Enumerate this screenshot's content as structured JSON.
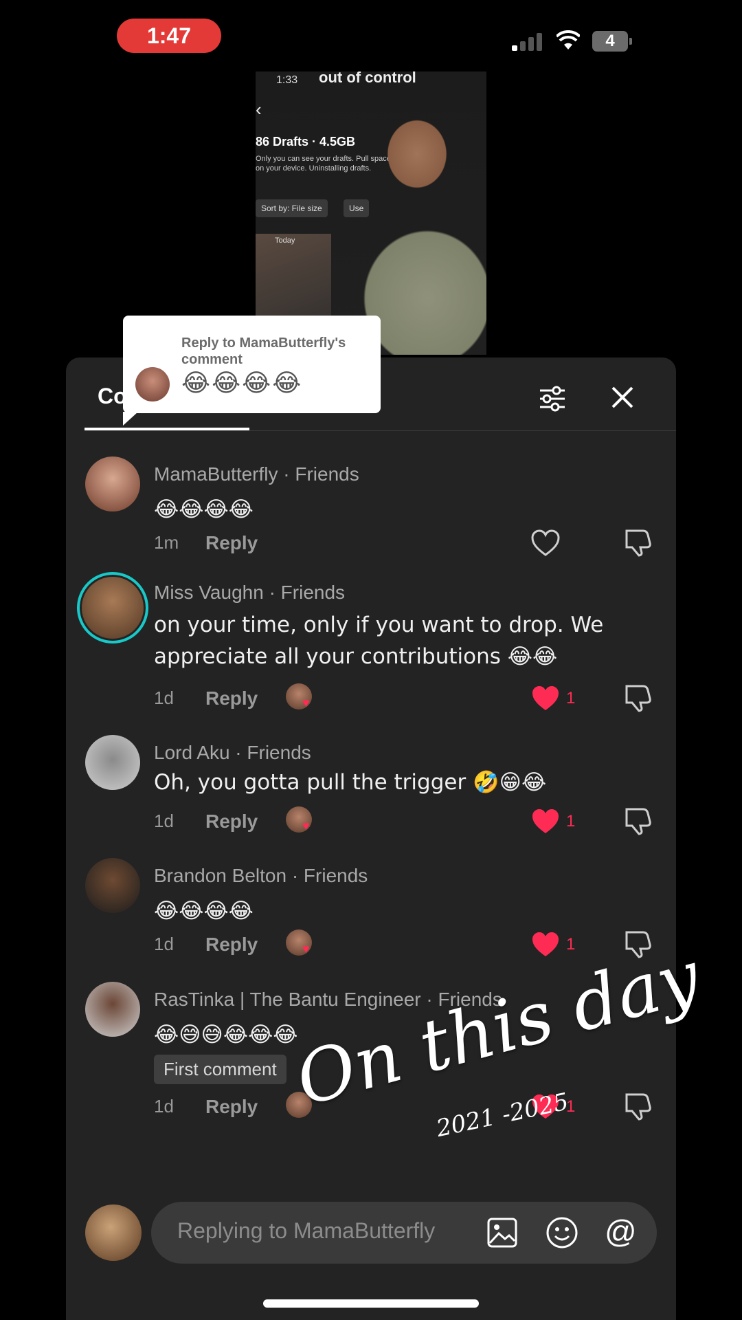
{
  "status_bar": {
    "time": "1:47",
    "battery": "4"
  },
  "video": {
    "inner_time": "1:33",
    "inner_caption": "out of control",
    "drafts_title": "86 Drafts · 4.5GB",
    "drafts_desc": "Only you can see your drafts. Pull space on your device. Uninstalling drafts.",
    "sort_label": "Sort by: File size",
    "sort_label_2": "Use",
    "thumb_label": "Today"
  },
  "reply_tooltip": {
    "title": "Reply to MamaButterfly's comment",
    "emoji": "😂😂😂😂"
  },
  "panel": {
    "tab_label": "Co",
    "comments": [
      {
        "name": "MamaButterfly · Friends",
        "text": "😂😂😂😂",
        "time": "1m",
        "reply": "Reply",
        "likes": ""
      },
      {
        "name": "Miss Vaughn · Friends",
        "text": "on your time, only if you want to drop. We appreciate all your contributions 😂😂",
        "time": "1d",
        "reply": "Reply",
        "likes": "1"
      },
      {
        "name": "Lord Aku · Friends",
        "text": "Oh, you gotta pull the trigger 🤣😁😂",
        "time": "1d",
        "reply": "Reply",
        "likes": "1"
      },
      {
        "name": "Brandon Belton · Friends",
        "text": "😂😂😂😂",
        "time": "1d",
        "reply": "Reply",
        "likes": "1"
      },
      {
        "name": "RasTinka | The Bantu Engineer · Friends",
        "text": "😂😅😅😂😂😂",
        "badge": "First comment",
        "time": "1d",
        "reply": "Reply",
        "likes": "1"
      }
    ]
  },
  "input": {
    "placeholder": "Replying to MamaButterfly",
    "at_symbol": "@"
  },
  "overlay": {
    "title": "On this day",
    "years": "2021 -2025"
  },
  "colors": {
    "accent_like": "#fe2c55",
    "panel_bg": "#232323",
    "status_time_bg": "#e33a37",
    "ring": "#18c9c9"
  },
  "icons": [
    "signal-icon",
    "wifi-icon",
    "battery-icon",
    "back-icon",
    "filter-icon",
    "close-icon",
    "heart-icon",
    "dislike-icon",
    "image-icon",
    "emoji-icon",
    "at-icon"
  ]
}
